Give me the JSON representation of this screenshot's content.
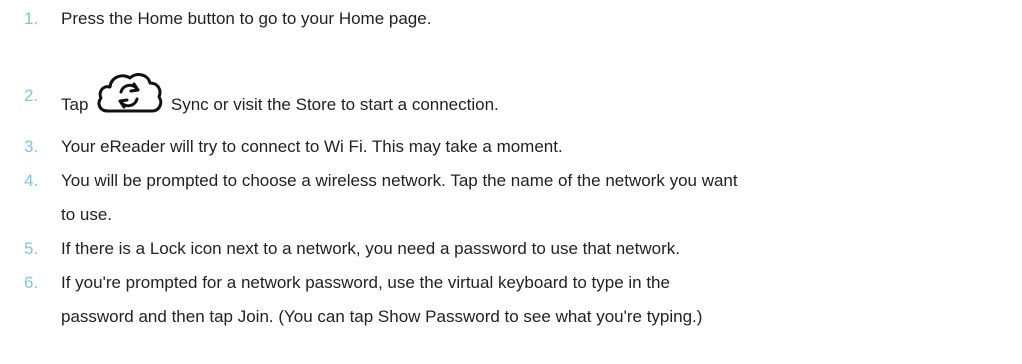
{
  "steps": [
    {
      "number": "1.",
      "text": "Press the Home button to go to your Home page."
    },
    {
      "number": "2.",
      "before": "Tap",
      "icon": "sync-cloud-icon",
      "after": "Sync or visit the Store to start a connection."
    },
    {
      "number": "3.",
      "text": "Your eReader will try to connect to Wi Fi. This may take a moment."
    },
    {
      "number": "4.",
      "line1": "You will be prompted to choose a wireless network. Tap the name of the network you want",
      "line2": "to use."
    },
    {
      "number": "5.",
      "text": "If there is a Lock icon next to a network, you need a password to use that network."
    },
    {
      "number": "6.",
      "line1": "If you're prompted for a network password, use the virtual keyboard to type in the",
      "line2": "password and then tap Join. (You can tap Show Password to see what you're typing.)"
    }
  ],
  "colors": {
    "number": "#7cc8d8",
    "text": "#222222",
    "background": "#ffffff"
  }
}
